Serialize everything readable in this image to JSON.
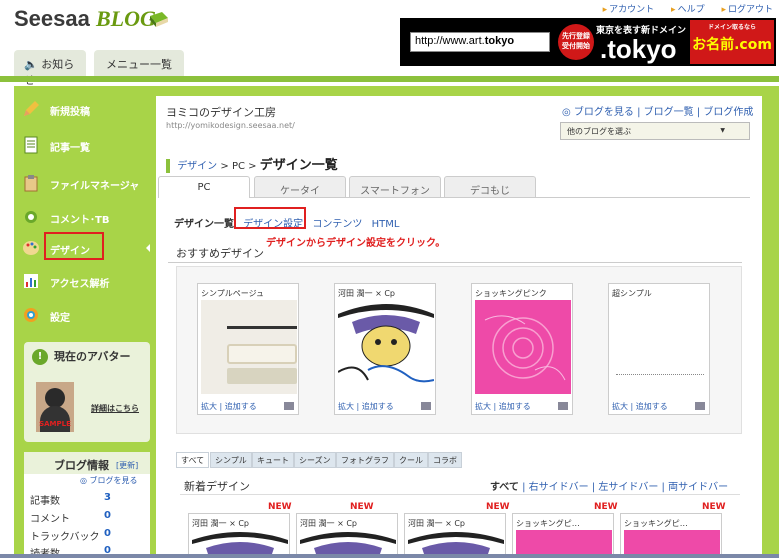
{
  "header": {
    "logo_main": "Seesaa",
    "logo_sub": "BLOG",
    "links": [
      "アカウント",
      "ヘルプ",
      "ログアウト"
    ],
    "tabs": [
      "お知らせ",
      "メニュー一覧"
    ]
  },
  "banner": {
    "url_prefix": "http://www.art.",
    "url_bold": "tokyo",
    "badge": "先行登録 受付開始",
    "headline": "東京を表す新ドメイン",
    "domain": ".tokyo",
    "brand": "お名前.com",
    "brand_top": "ドメイン取るなら"
  },
  "sidebar": {
    "items": [
      {
        "label": "新規投稿",
        "icon": "pencil-icon"
      },
      {
        "label": "記事一覧",
        "icon": "document-icon"
      },
      {
        "label": "ファイルマネージャ",
        "icon": "clipboard-icon"
      },
      {
        "label": "コメント･TB",
        "icon": "comment-icon"
      },
      {
        "label": "デザイン",
        "icon": "palette-icon"
      },
      {
        "label": "アクセス解析",
        "icon": "chart-icon"
      },
      {
        "label": "設定",
        "icon": "gear-icon"
      }
    ],
    "avatar": {
      "title": "現在のアバター",
      "sample": "SAMPLE",
      "link": "詳細はこちら"
    },
    "blog_info": {
      "title": "ブログ情報",
      "update": "[更新]",
      "view": "ブログを見る",
      "stats": [
        {
          "label": "記事数",
          "value": "3"
        },
        {
          "label": "コメント",
          "value": "0"
        },
        {
          "label": "トラックバック",
          "value": "0"
        },
        {
          "label": "読者数",
          "value": "0"
        }
      ]
    }
  },
  "blog": {
    "title": "ヨミコのデザイン工房",
    "url": "http://yomikodesign.seesaa.net/",
    "link_view": "ブログを見る",
    "link_list": "ブログ一覧",
    "link_create": "ブログ作成",
    "select": "他のブログを選ぶ"
  },
  "breadcrumb": {
    "design": "デザイン",
    "pc": "PC",
    "current": "デザイン一覧"
  },
  "device_tabs": [
    "PC",
    "ケータイ",
    "スマートフォン",
    "デコもじ"
  ],
  "sub_nav": {
    "current": "デザイン一覧",
    "settings": "デザイン設定",
    "contents": "コンテンツ",
    "html": "HTML"
  },
  "annotation": "デザインからデザイン設定をクリック。",
  "recommended": {
    "title": "おすすめデザイン",
    "cards": [
      {
        "name": "シンプルページュ",
        "style": "simple-beige"
      },
      {
        "name": "河田 潤一 × Cp",
        "style": "illust"
      },
      {
        "name": "ショッキングピンク",
        "style": "pink"
      },
      {
        "name": "超シンプル",
        "style": "blank"
      }
    ],
    "action_zoom": "拡大",
    "action_add": "追加する"
  },
  "filter_tabs": [
    "すべて",
    "シンプル",
    "キュート",
    "シーズン",
    "フォトグラフ",
    "クール",
    "コラボ"
  ],
  "new_designs": {
    "title": "新着デザイン",
    "filter_all": "すべて",
    "filter_right": "右サイドバー",
    "filter_left": "左サイドバー",
    "filter_both": "両サイドバー",
    "badge": "NEW",
    "cards": [
      {
        "name": "河田 潤一 × Cp",
        "style": "illust"
      },
      {
        "name": "河田 潤一 × Cp",
        "style": "illust"
      },
      {
        "name": "河田 潤一 × Cp",
        "style": "illust"
      },
      {
        "name": "ショッキングピ…",
        "style": "pink"
      },
      {
        "name": "ショッキングピ…",
        "style": "pink"
      }
    ]
  },
  "colors": {
    "accent_green": "#a8d448",
    "link_blue": "#3060b0",
    "highlight_red": "#e02020"
  }
}
